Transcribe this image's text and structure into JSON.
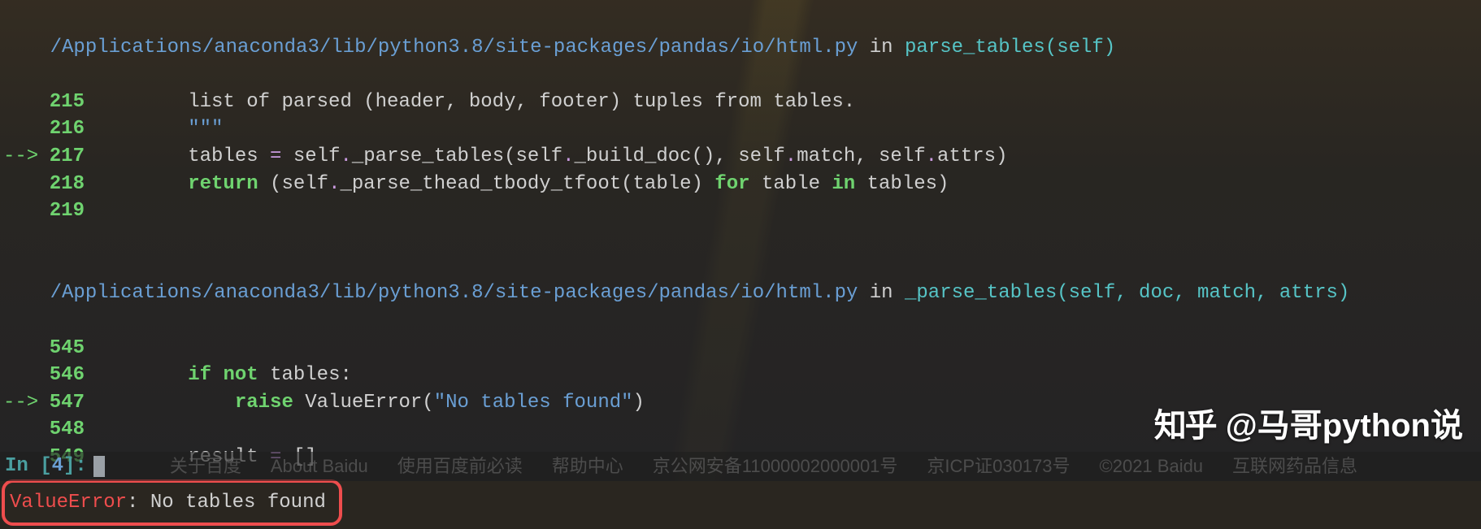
{
  "frame1": {
    "path": "/Applications/anaconda3/lib/python3.8/site-packages/pandas/io/html.py",
    "in": " in ",
    "func": "parse_tables",
    "sig": "(self)",
    "lines": {
      "l215": {
        "no": "215",
        "text": "        list of parsed (header, body, footer) tuples from tables."
      },
      "l216": {
        "no": "216",
        "text": "        \"\"\""
      },
      "l217": {
        "no": "217",
        "indent": "        ",
        "tables": "tables ",
        "eq": "= ",
        "self1": "self",
        "dot1": ".",
        "m1": "_parse_tables",
        "p1": "(",
        "self2": "self",
        "dot2": ".",
        "m2": "_build_doc",
        "p2": "()",
        "c1": ", ",
        "self3": "self",
        "dot3": ".",
        "m3": "match",
        "c2": ", ",
        "self4": "self",
        "dot4": ".",
        "m4": "attrs",
        "p3": ")"
      },
      "l218": {
        "no": "218",
        "indent": "        ",
        "ret": "return",
        "sp": " ",
        "p1": "(",
        "self1": "self",
        "dot1": ".",
        "m1": "_parse_thead_tbody_tfoot",
        "p2": "(",
        "arg": "table",
        "p3": ")",
        "sp2": " ",
        "for": "for",
        "sp3": " ",
        "var": "table",
        "sp4": " ",
        "in": "in",
        "sp5": " ",
        "it": "tables",
        "p4": ")"
      },
      "l219": {
        "no": "219"
      }
    }
  },
  "frame2": {
    "path": "/Applications/anaconda3/lib/python3.8/site-packages/pandas/io/html.py",
    "in": " in ",
    "func": "_parse_tables",
    "sig": "(self, doc, match, attrs)",
    "lines": {
      "l545": {
        "no": "545"
      },
      "l546": {
        "no": "546",
        "indent": "        ",
        "if": "if",
        "sp": " ",
        "not": "not",
        "sp2": " ",
        "var": "tables",
        "colon": ":"
      },
      "l547": {
        "no": "547",
        "indent": "            ",
        "raise": "raise",
        "sp": " ",
        "exc": "ValueError",
        "p1": "(",
        "str": "\"No tables found\"",
        "p2": ")"
      },
      "l548": {
        "no": "548"
      },
      "l549": {
        "no": "549",
        "indent": "        ",
        "var": "result ",
        "eq": "= ",
        "val": "[]"
      }
    }
  },
  "arrow": "-->",
  "error": {
    "name": "ValueError",
    "msg": ": No tables found"
  },
  "prompt": {
    "prefix": "In [",
    "num": "4",
    "suffix": "]:"
  },
  "footer": {
    "l1": "关于百度",
    "l2": "About Baidu",
    "l3": "使用百度前必读",
    "l4": "帮助中心",
    "l5": "京公网安备11000002000001号",
    "l6": "京ICP证030173号",
    "l7": "©2021 Baidu",
    "l8": "互联网药品信息"
  },
  "watermark": {
    "logo": "知乎",
    "text": "@马哥python说"
  }
}
